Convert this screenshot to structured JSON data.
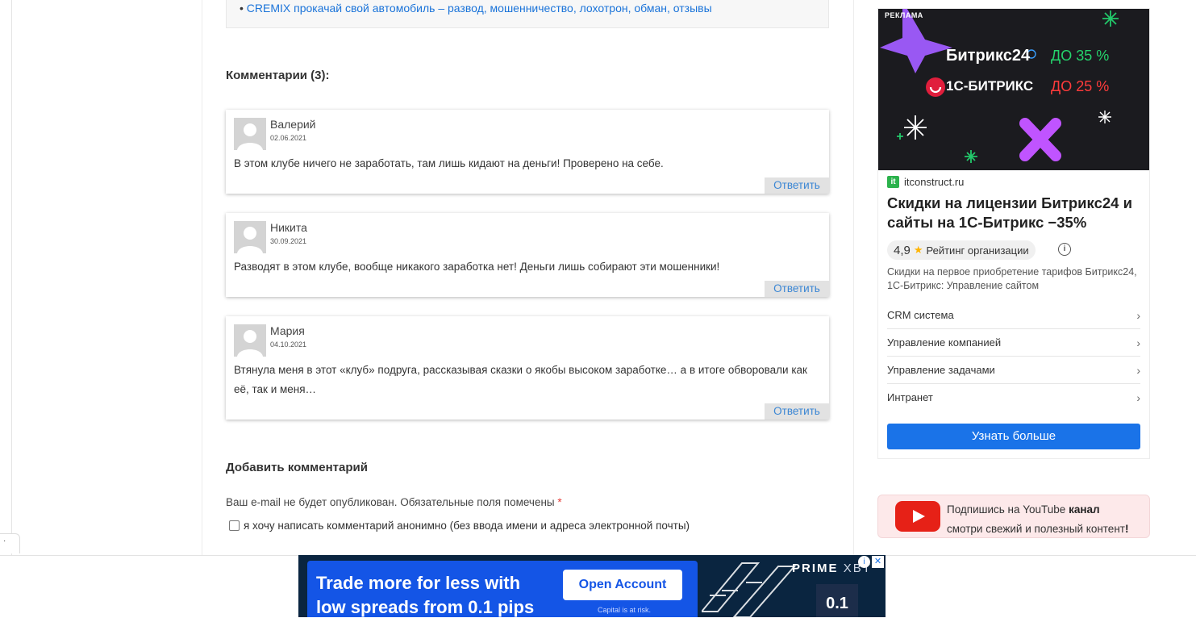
{
  "related": {
    "bullet": "•",
    "link": "CREMIX прокачай свой автомобиль – развод, мошенничество, лохотрон, обман, отзывы"
  },
  "comments": {
    "title": "Комментарии (3):",
    "reply_label": "Ответить",
    "items": [
      {
        "author": "Валерий",
        "date": "02.06.2021",
        "text": "В этом клубе ничего не заработать, там лишь кидают на деньги! Проверено на себе."
      },
      {
        "author": "Никита",
        "date": "30.09.2021",
        "text": "Разводят в этом клубе, вообще никакого заработка нет! Деньги лишь собирают эти мошенники!"
      },
      {
        "author": "Мария",
        "date": "04.10.2021",
        "text": "Втянула меня в этот «клуб» подруга, рассказывая сказки о якобы высоком заработке… а в итоге обворовали как её, так и меня…"
      }
    ]
  },
  "comment_form": {
    "title": "Добавить комментарий",
    "note": "Ваш e-mail не будет опубликован. Обязательные поля помечены",
    "required_mark": "*",
    "anonymous_label": "я хочу написать комментарий анонимно (без ввода имени и адреса электронной почты)"
  },
  "sidebar_ad": {
    "label": "РЕКЛАМА",
    "brand1": "Битрикс24",
    "discount1": "ДО 35 %",
    "brand2": "1С-БИТРИКС",
    "discount2": "ДО 25 %",
    "site_badge": "it",
    "site": "itconstruct.ru",
    "headline": "Скидки на лицензии Битрикс24 и сайты на 1С-Битрикс −35%",
    "rating_score": "4,9",
    "rating_label": "Рейтинг организации",
    "description": "Скидки на первое приобретение тарифов Битрикс24, 1С-Битрикс: Управление сайтом",
    "links": [
      "CRM система",
      "Управление компанией",
      "Управление задачами",
      "Интранет"
    ],
    "cta": "Узнать больше"
  },
  "youtube_box": {
    "line1_prefix": "Подпишись на YouTube",
    "line1_bold": "канал",
    "line2_prefix": "смотри свежий и полезный контент",
    "line2_bold": "!"
  },
  "bottom_banner": {
    "headline_line1": "Trade more for less with",
    "headline_line2": "low spreads from 0.1 pips",
    "button": "Open Account",
    "risk": "Capital is at risk.",
    "brand": "PRIME",
    "brand_suffix": "XBT",
    "value": "0.1"
  },
  "colors": {
    "link": "#1a73d9",
    "reply": "#3a86d4",
    "cta": "#1a73e8",
    "banner_blue": "#1455e6",
    "youtube_red": "#e62117"
  }
}
